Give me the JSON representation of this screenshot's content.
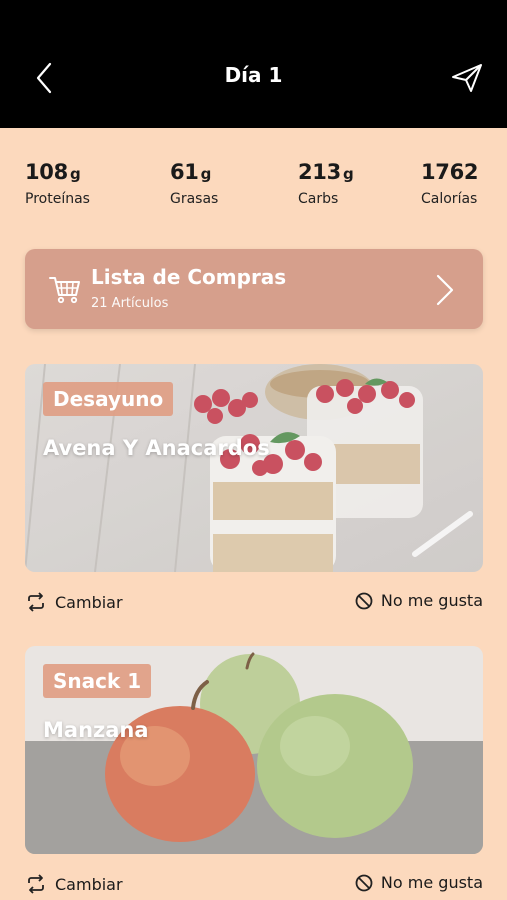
{
  "header": {
    "title": "Día 1",
    "back_icon": "back-chevron-icon",
    "send_icon": "paper-plane-icon"
  },
  "macros": [
    {
      "value": "108",
      "unit": "g",
      "label": "Proteínas"
    },
    {
      "value": "61",
      "unit": "g",
      "label": "Grasas"
    },
    {
      "value": "213",
      "unit": "g",
      "label": "Carbs"
    },
    {
      "value": "1762",
      "unit": "",
      "label": "Calorías"
    }
  ],
  "shopping": {
    "title": "Lista de Compras",
    "subtitle": "21 Artículos",
    "icon": "shopping-cart-icon"
  },
  "meals": [
    {
      "type": "Desayuno",
      "dish": "Avena Y Anacardos",
      "change": "Cambiar",
      "dislike": "No me gusta"
    },
    {
      "type": "Snack 1",
      "dish": "Manzana",
      "change": "Cambiar",
      "dislike": "No me gusta"
    }
  ],
  "colors": {
    "background": "#fcd9bd",
    "header": "#000000",
    "card": "#d69f8c",
    "badge": "#e09e84"
  }
}
